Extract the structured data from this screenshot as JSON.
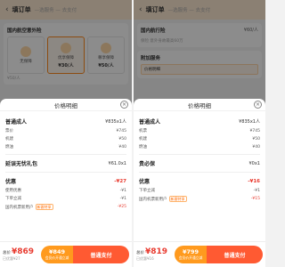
{
  "left": {
    "header": {
      "back": "‹",
      "title": "填订单",
      "steps": "—选服务 — 去支付"
    },
    "bg": {
      "insurance_title": "国内航空意外险",
      "insurance_options": [
        {
          "name": "无保障",
          "price": "",
          "selected": false
        },
        {
          "name": "优享保障",
          "price": "¥30/人",
          "selected": true
        },
        {
          "name": "尊享保障",
          "price": "¥50/人",
          "selected": false
        }
      ],
      "sub_price": "¥50/人"
    },
    "modal": {
      "title": "价格明细",
      "adult": {
        "name": "普通成人",
        "value": "¥835x1人"
      },
      "adult_lines": [
        {
          "label": "票价",
          "value": "¥745"
        },
        {
          "label": "机建",
          "value": "¥50"
        },
        {
          "label": "燃油",
          "value": "¥40"
        }
      ],
      "extra": {
        "name": "延误无忧礼包",
        "value": "¥61.0x1"
      },
      "discount": {
        "name": "优惠",
        "value": "-¥27"
      },
      "discount_lines": [
        {
          "label": "使用优惠",
          "value": "-¥1",
          "tag": ""
        },
        {
          "label": "下单立减",
          "value": "-¥1",
          "tag": ""
        },
        {
          "label": "国内机票新用户",
          "value": "-¥25",
          "tag": "新客特享"
        }
      ]
    },
    "bottom": {
      "total_label": "总价",
      "total_price": "¥869",
      "total_sub": "已优惠¥27",
      "member_price": "¥849",
      "member_sub": "会员价开通立减",
      "pay_label": "普通支付"
    }
  },
  "right": {
    "header": {
      "back": "‹",
      "title": "填订单",
      "steps": "—选服务 — 去支付"
    },
    "bg": {
      "insurance_title": "国内航行险",
      "insurance_price": "¥60/人",
      "insurance_sub": "保险 意外身故最高60万",
      "addon_title": "附加服务",
      "addon_item": "价格明细"
    },
    "modal": {
      "title": "价格明细",
      "adult": {
        "name": "普通成人",
        "value": "¥835x1人"
      },
      "adult_lines": [
        {
          "label": "机票",
          "value": "¥745"
        },
        {
          "label": "机建",
          "value": "¥50"
        },
        {
          "label": "燃油",
          "value": "¥40"
        }
      ],
      "extra": {
        "name": "贵必保",
        "value": "¥0x1"
      },
      "discount": {
        "name": "优惠",
        "value": "-¥16"
      },
      "discount_lines": [
        {
          "label": "下单立减",
          "value": "-¥1",
          "tag": ""
        },
        {
          "label": "国内机票新用户",
          "value": "-¥15",
          "tag": "新客特享"
        }
      ]
    },
    "bottom": {
      "total_label": "总价",
      "total_price": "¥819",
      "total_sub": "已优惠¥16",
      "member_price": "¥799",
      "member_sub": "会员价开通立减",
      "pay_label": "普通支付"
    }
  },
  "colors": {
    "accent": "#ff9a1e",
    "red": "#e83a2f",
    "pay": "#ff5a32"
  }
}
